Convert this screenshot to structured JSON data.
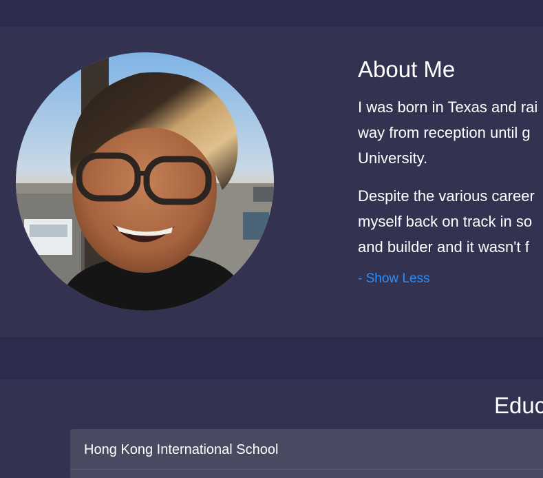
{
  "about": {
    "title": "About Me",
    "paragraph1": {
      "line1": "I was born in Texas and rai",
      "line2": "way from reception until g",
      "line3": "University."
    },
    "paragraph2": {
      "line1": "Despite the various career",
      "line2": "myself back on track in so",
      "line3": "and builder and it wasn't f"
    },
    "toggle_label": "- Show Less"
  },
  "education": {
    "title": "Educ",
    "schools": [
      {
        "name": "Hong Kong International School"
      }
    ]
  },
  "colors": {
    "page_background": "#2c2c4f",
    "section_background": "#333351",
    "card_background": "#474a60",
    "link": "#2d8cf5",
    "text": "#ffffff"
  },
  "icons": {
    "avatar": "profile-photo"
  }
}
